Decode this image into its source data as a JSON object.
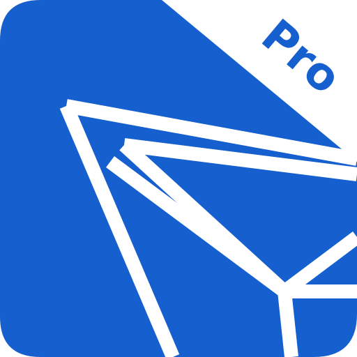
{
  "icon": {
    "name": "tron-pro-app-icon",
    "badge_text": "Pro",
    "symbol": "tron-logo-icon",
    "colors": {
      "background": "#165FCF",
      "foreground": "#FFFFFF"
    }
  }
}
